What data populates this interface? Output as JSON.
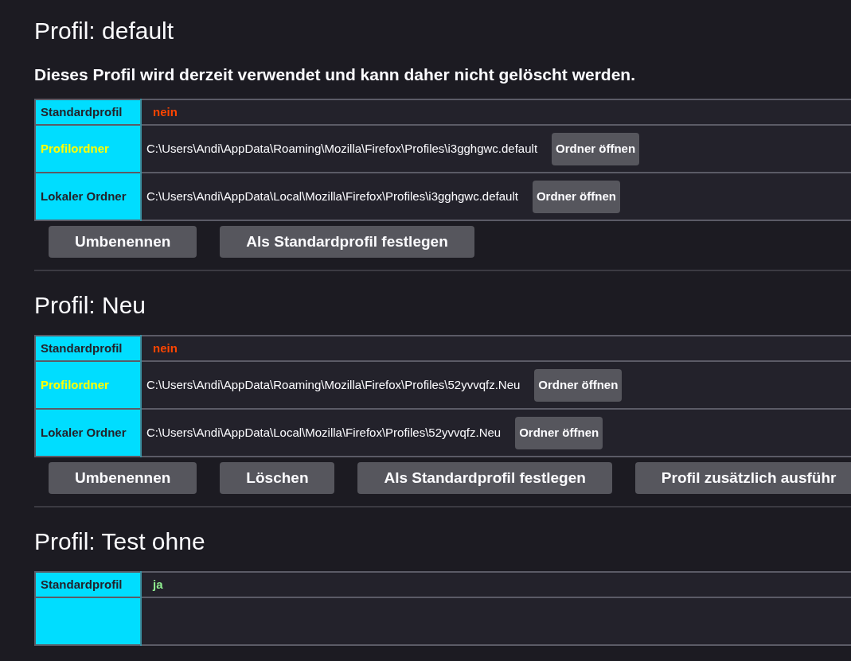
{
  "profiles": [
    {
      "title": "Profil: default",
      "notice": "Dieses Profil wird derzeit verwendet und kann daher nicht gelöscht werden.",
      "rows": [
        {
          "kind": "flag",
          "label": "Standardprofil",
          "highlighted": false,
          "value": "nein",
          "on": false
        },
        {
          "kind": "path",
          "label": "Profilordner",
          "highlighted": true,
          "value": "C:\\Users\\Andi\\AppData\\Roaming\\Mozilla\\Firefox\\Profiles\\i3gghgwc.default",
          "button": "Ordner öffnen"
        },
        {
          "kind": "path",
          "label": "Lokaler Ordner",
          "highlighted": false,
          "value": "C:\\Users\\Andi\\AppData\\Local\\Mozilla\\Firefox\\Profiles\\i3gghgwc.default",
          "button": "Ordner öffnen"
        }
      ],
      "actions": [
        "Umbenennen",
        "Als Standardprofil festlegen"
      ]
    },
    {
      "title": "Profil: Neu",
      "rows": [
        {
          "kind": "flag",
          "label": "Standardprofil",
          "highlighted": false,
          "value": "nein",
          "on": false
        },
        {
          "kind": "path",
          "label": "Profilordner",
          "highlighted": true,
          "value": "C:\\Users\\Andi\\AppData\\Roaming\\Mozilla\\Firefox\\Profiles\\52yvvqfz.Neu",
          "button": "Ordner öffnen"
        },
        {
          "kind": "path",
          "label": "Lokaler Ordner",
          "highlighted": false,
          "value": "C:\\Users\\Andi\\AppData\\Local\\Mozilla\\Firefox\\Profiles\\52yvvqfz.Neu",
          "button": "Ordner öffnen"
        }
      ],
      "actions": [
        "Umbenennen",
        "Löschen",
        "Als Standardprofil festlegen",
        "Profil zusätzlich ausführ"
      ]
    },
    {
      "title": "Profil: Test ohne",
      "rows": [
        {
          "kind": "flag",
          "label": "Standardprofil",
          "highlighted": false,
          "value": "ja",
          "on": true
        },
        {
          "kind": "cut"
        }
      ]
    }
  ]
}
